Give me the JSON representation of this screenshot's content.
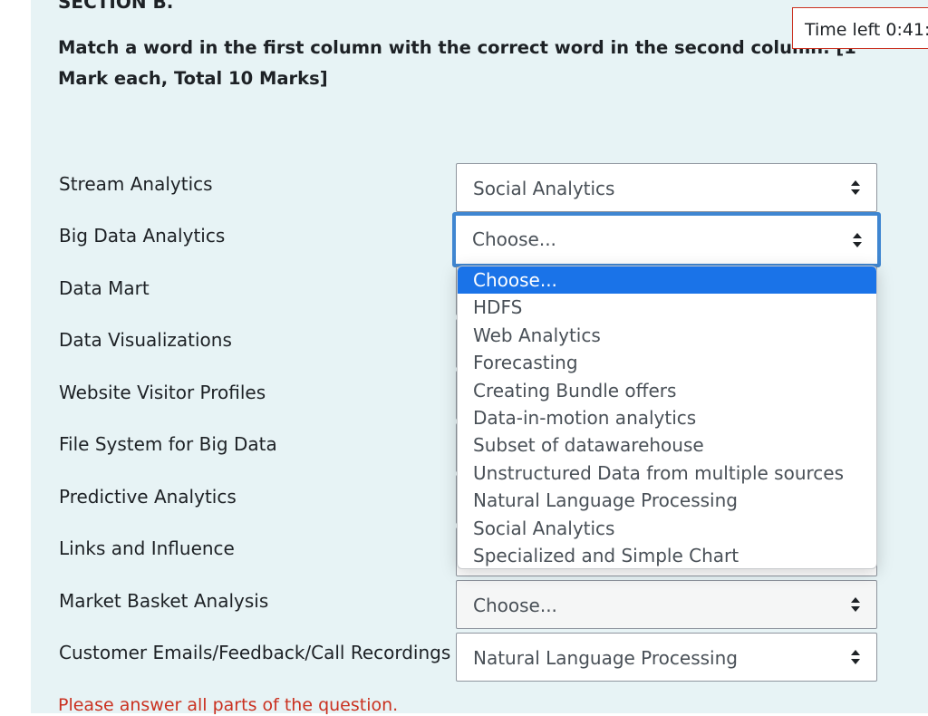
{
  "section": {
    "heading": "SECTION B.",
    "instructions": "Match a word in the first column with the correct word in the second column. [1 Mark each, Total 10 Marks]"
  },
  "timer": {
    "text": "Time left 0:41:"
  },
  "rows": [
    {
      "stem": "Stream Analytics",
      "selected": "Social Analytics"
    },
    {
      "stem": "Big Data Analytics",
      "selected": "Choose..."
    },
    {
      "stem": "Data Mart",
      "selected": ""
    },
    {
      "stem": "Data Visualizations",
      "selected": ""
    },
    {
      "stem": "Website Visitor Profiles",
      "selected": ""
    },
    {
      "stem": "File System for Big Data",
      "selected": ""
    },
    {
      "stem": "Predictive Analytics",
      "selected": ""
    },
    {
      "stem": "Links and Influence",
      "selected": ""
    },
    {
      "stem": "Market Basket Analysis",
      "selected": "Choose..."
    },
    {
      "stem": "Customer Emails/Feedback/Call Recordings",
      "selected": "Natural Language Processing"
    }
  ],
  "dropdown": {
    "options": [
      "Choose...",
      "HDFS",
      "Web Analytics",
      "Forecasting",
      "Creating Bundle offers",
      "Data-in-motion analytics",
      "Subset of datawarehouse",
      "Unstructured Data from multiple sources",
      "Natural Language Processing",
      "Social Analytics",
      "Specialized and Simple Chart"
    ],
    "highlighted_index": 0
  },
  "validation": {
    "message": "Please answer all parts of the question."
  },
  "colors": {
    "panel_bg": "#e7f3f5",
    "focus_border": "#3f86d1",
    "highlight": "#1a73e8",
    "error": "#ca3120"
  }
}
